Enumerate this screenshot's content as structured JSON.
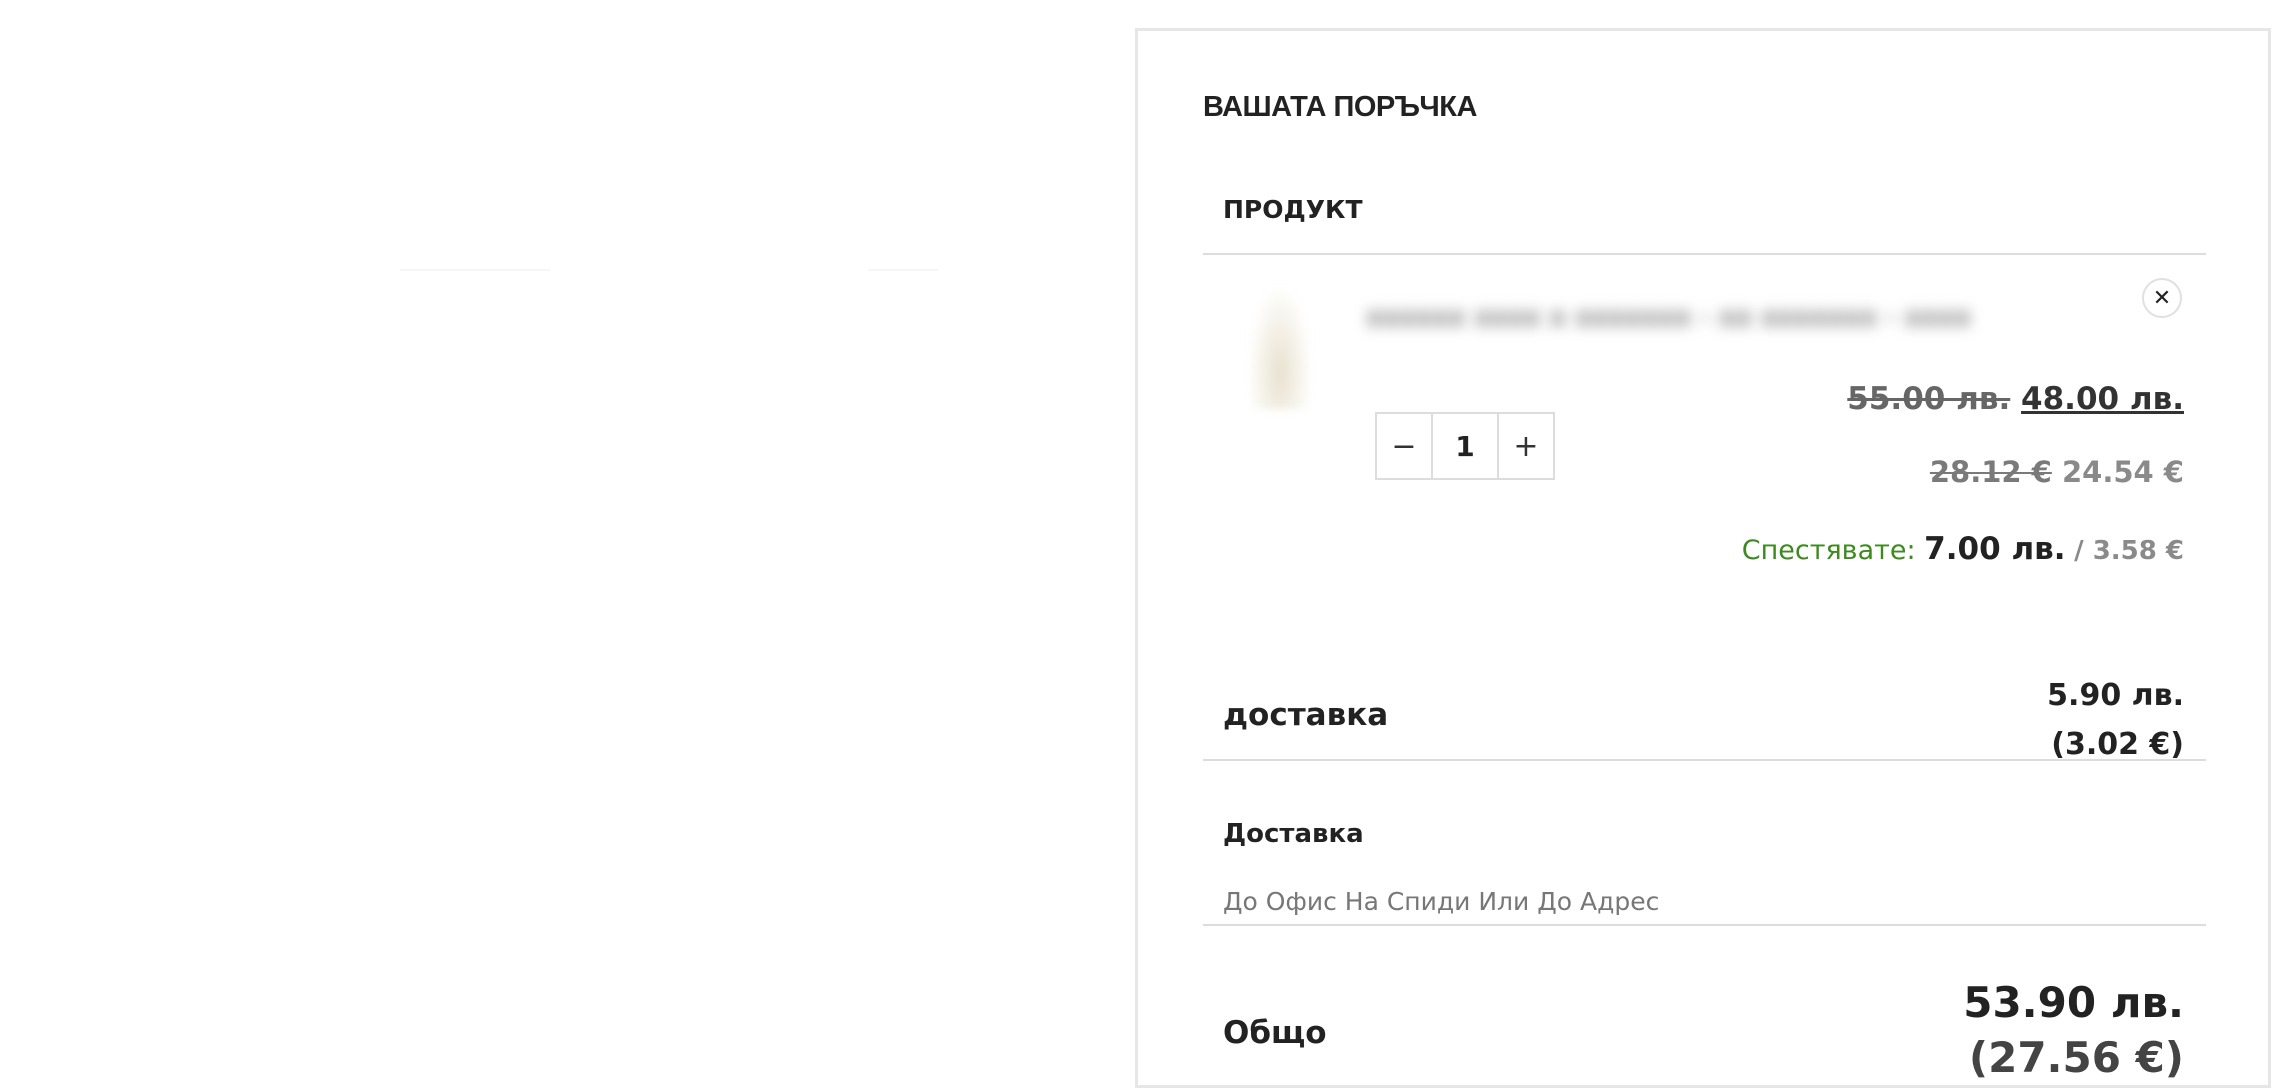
{
  "order": {
    "title": "ВАШАТА ПОРЪЧКА",
    "column_header": "ПРОДУКТ"
  },
  "item": {
    "name": "xxxxxx xxxx x xxxxxxx - xx xxxxxxx - xxxx",
    "remove_icon": "close-icon",
    "remove_glyph": "✕",
    "price_bgn_old": "55.00 лв.",
    "price_bgn_new": "48.00 лв.",
    "price_eur_old": "28.12 €",
    "price_eur_new": "24.54 €",
    "quantity": "1",
    "minus_glyph": "−",
    "plus_glyph": "+",
    "savings_label": "Спестявате:",
    "savings_bgn": "7.00 лв.",
    "savings_eur": "/ 3.58 €"
  },
  "shipping": {
    "label": "доставка",
    "price_bgn": "5.90 лв.",
    "price_eur": "(3.02 €)"
  },
  "delivery": {
    "title": "Доставка",
    "option": "До Офис На Спиди Или До Адрес"
  },
  "total": {
    "label": "Общо",
    "price_bgn": "53.90 лв.",
    "price_eur": "(27.56 €)"
  },
  "colors": {
    "savings_green": "#3d8a1f",
    "muted_gray": "#8a8a8a",
    "border": "#e6e6e6"
  }
}
